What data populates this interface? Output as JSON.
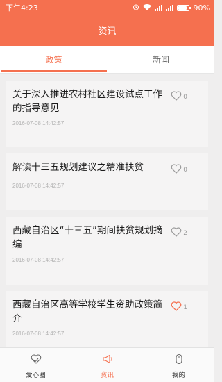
{
  "status_bar": {
    "time": "下午4:23",
    "battery": "90%",
    "battery_level": 0.9
  },
  "header": {
    "title": "资讯"
  },
  "tabs": [
    {
      "label": "政策",
      "active": true
    },
    {
      "label": "新闻",
      "active": false
    }
  ],
  "articles": [
    {
      "title": "关于深入推进农村社区建设试点工作的指导意见",
      "time": "2016-07-08 14:42:57",
      "likes": "0",
      "liked": false
    },
    {
      "title": "解读十三五规划建议之精准扶贫",
      "time": "2016-07-08 14:42:57",
      "likes": "0",
      "liked": false
    },
    {
      "title": "西藏自治区“十三五”期间扶贫规划摘编",
      "time": "2016-07-08 14:42:57",
      "likes": "2",
      "liked": false
    },
    {
      "title": "西藏自治区高等学校学生资助政策简介",
      "time": "2016-07-08 14:42:57",
      "likes": "1",
      "liked": true
    }
  ],
  "bottom_nav": [
    {
      "label": "爱心圈",
      "icon": "heart-hands-icon",
      "active": false
    },
    {
      "label": "资讯",
      "icon": "megaphone-icon",
      "active": true
    },
    {
      "label": "我的",
      "icon": "mouse-icon",
      "active": false
    }
  ],
  "colors": {
    "accent": "#f5704f",
    "background": "#efeeee",
    "card": "#f5f4f4"
  }
}
